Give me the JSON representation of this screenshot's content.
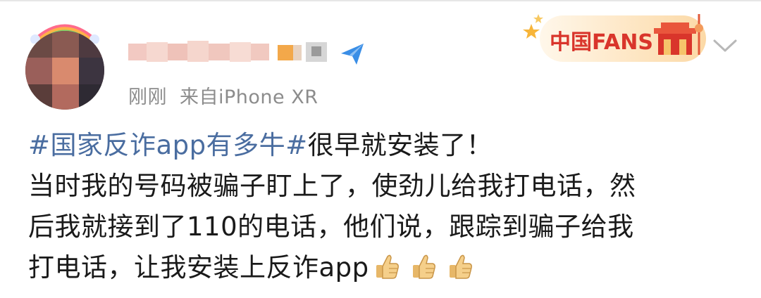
{
  "post": {
    "meta_time": "刚刚",
    "meta_source": "来自iPhone XR",
    "hashtag": "#国家反诈app有多牛#",
    "line1_rest": "很早就安装了！",
    "line2": "当时我的号码被骗子盯上了，使劲儿给我打电话，然",
    "line3": "后我就接到了110的电话，他们说，跟踪到骗子给我",
    "line4": "打电话，让我安装上反诈app",
    "emojis": [
      "thumbs-up-icon",
      "thumbs-up-icon",
      "thumbs-up-icon"
    ]
  },
  "badge": {
    "text": "中国FANS"
  },
  "colors": {
    "hashtag": "#4a6da0",
    "meta": "#8c8c8c",
    "text": "#1a1a1a",
    "badge_red": "#d9352b",
    "badge_bg": "#fde9c9",
    "verify_blue": "#3a8ee6"
  }
}
